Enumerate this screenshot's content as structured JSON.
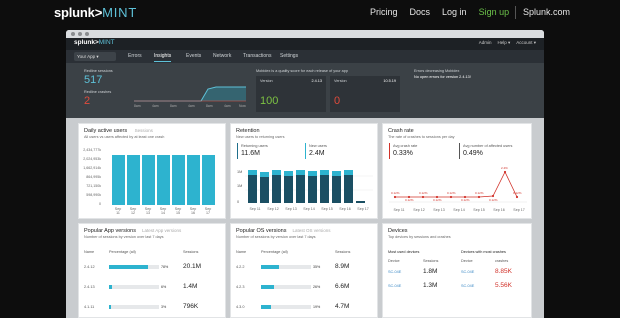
{
  "topnav": {
    "logo_main": "splunk>",
    "logo_sub": "MINT",
    "links": [
      "Pricing",
      "Docs",
      "Log in",
      "Sign up"
    ],
    "splunk_com": "Splunk.com"
  },
  "app": {
    "logo_main": "splunk>",
    "logo_sub": "MINT",
    "header_links": [
      "Admin",
      "Help ▾",
      "Account ▾"
    ],
    "app_select": "Your App ▾",
    "tabs": [
      "Errors",
      "Insights",
      "Events",
      "Network",
      "Transactions",
      "Settings"
    ],
    "active_tab": "Insights"
  },
  "banner": {
    "redline_sessions_label": "Redline sessions",
    "redline_sessions": "517",
    "redline_crashes_label": "Redline crashes",
    "redline_crashes": "2",
    "mini_x": [
      "8am",
      "4am",
      "8am",
      "4am",
      "8am",
      "4am",
      "Now"
    ],
    "mobidex_title": "Mobidex is a quality score for each release of your app",
    "version_a_label": "Version",
    "version_a": "2.4.13",
    "score_a": "100",
    "version_b_label": "Version",
    "version_b": "10.5.19",
    "score_b": "0",
    "errors_title": "Errors decreasing Mobidex",
    "errors_msg": "No open errors for version 2.4.13!"
  },
  "dau": {
    "title": "Daily active users",
    "title_alt": "Sessions",
    "subtitle": "All users vs users affected by at least one crash",
    "yticks": [
      "2,434,777k",
      "2,024,953k",
      "1,662,914k",
      "864,995k",
      "721,150k",
      "598,990k",
      "0"
    ],
    "x": [
      "Sep 11",
      "Sep 12",
      "Sep 13",
      "Sep 14",
      "Sep 15",
      "Sep 16",
      "Sep 17"
    ]
  },
  "retention": {
    "title": "Retention",
    "subtitle": "New users to returning users",
    "returning_label": "Returning users",
    "returning": "11.6M",
    "new_label": "New users",
    "new": "2.4M",
    "ylabels": [
      "1M",
      "1M",
      "0"
    ],
    "x": [
      "Sep 11",
      "Sep 12",
      "Sep 13",
      "Sep 14",
      "Sep 15",
      "Sep 16",
      "Sep 17"
    ]
  },
  "crash": {
    "title": "Crash rate",
    "subtitle": "The rate of crashes to sessions per day",
    "avg_label": "Avg crash rate",
    "avg": "0.33%",
    "affected_label": "Avg number of affected users",
    "affected": "0.49%",
    "x": [
      "Sep 11",
      "Sep 12",
      "Sep 13",
      "Sep 14",
      "Sep 15",
      "Sep 16",
      "Sep 17"
    ],
    "point_labels": [
      "0.12%",
      "0.12%",
      "0.12%",
      "0.12%",
      "0.12%",
      "0.12%",
      "0.12%",
      "0.12%",
      "2.4%",
      "0.12%"
    ]
  },
  "app_versions": {
    "title": "Popular App versions",
    "title_alt": "Latest App versions",
    "subtitle": "Number of sessions by version over last 7 days",
    "col_name": "Name",
    "col_pct": "Percentage (all)",
    "col_sessions": "Sessions",
    "rows": [
      {
        "name": "2.4.12",
        "pct": "78%",
        "sessions": "20.1M"
      },
      {
        "name": "2.4.13",
        "pct": "6%",
        "sessions": "1.4M"
      },
      {
        "name": "4.1.11",
        "pct": "3%",
        "sessions": "796K"
      }
    ]
  },
  "os_versions": {
    "title": "Popular OS versions",
    "title_alt": "Latest OS versions",
    "subtitle": "Number of sessions by version over last 7 days",
    "col_name": "Name",
    "col_pct": "Percentage (all)",
    "col_sessions": "Sessions",
    "rows": [
      {
        "name": "4.2.2",
        "pct": "35%",
        "sessions": "8.9M"
      },
      {
        "name": "4.2.3",
        "pct": "26%",
        "sessions": "6.6M"
      },
      {
        "name": "4.3.0",
        "pct": "19%",
        "sessions": "4.7M"
      }
    ]
  },
  "devices": {
    "title": "Devices",
    "subtitle": "Top devices by sessions and crashes",
    "most_used": "Most used devices",
    "most_crashes": "Devices with most crashes",
    "col_device": "Device",
    "col_sessions": "Sessions",
    "col_crashes": "crashes",
    "used_rows": [
      {
        "device": "SC-04E",
        "value": "1.8M"
      },
      {
        "device": "SC-04E",
        "value": "1.3M"
      }
    ],
    "crash_rows": [
      {
        "device": "SC-04E",
        "value": "8.85K"
      },
      {
        "device": "SC-04E",
        "value": "5.56K"
      }
    ]
  }
}
